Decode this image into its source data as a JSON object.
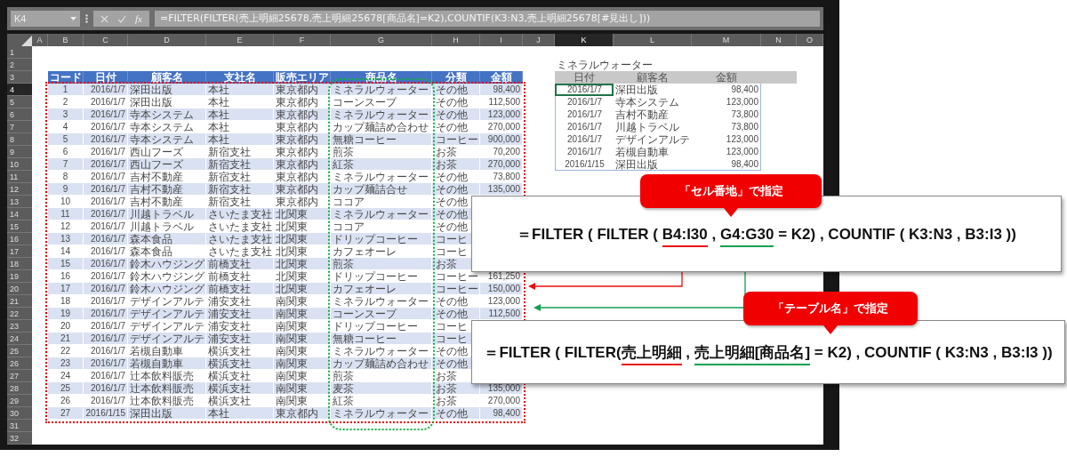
{
  "formula_bar": {
    "name_box": "K4",
    "fx": "fx",
    "formula": "=FILTER(FILTER(売上明細25678,売上明細25678[商品名]=K2),COUNTIF(K3:N3,売上明細25678[#見出し]))"
  },
  "column_headers": [
    {
      "label": "A",
      "selected": false
    },
    {
      "label": "B",
      "selected": false
    },
    {
      "label": "C",
      "selected": false
    },
    {
      "label": "D",
      "selected": false
    },
    {
      "label": "E",
      "selected": false
    },
    {
      "label": "F",
      "selected": false
    },
    {
      "label": "G",
      "selected": false
    },
    {
      "label": "H",
      "selected": false
    },
    {
      "label": "I",
      "selected": false
    },
    {
      "label": "J",
      "selected": false
    },
    {
      "label": "K",
      "selected": true
    },
    {
      "label": "L",
      "selected": false
    },
    {
      "label": "M",
      "selected": false
    },
    {
      "label": "N",
      "selected": false
    },
    {
      "label": "O",
      "selected": false
    }
  ],
  "row_numbers": [
    {
      "label": "1",
      "selected": false
    },
    {
      "label": "2",
      "selected": false
    },
    {
      "label": "3",
      "selected": false
    },
    {
      "label": "4",
      "selected": true
    },
    {
      "label": "5",
      "selected": false
    },
    {
      "label": "6",
      "selected": false
    },
    {
      "label": "7",
      "selected": false
    },
    {
      "label": "8",
      "selected": false
    },
    {
      "label": "9",
      "selected": false
    },
    {
      "label": "10",
      "selected": false
    },
    {
      "label": "11",
      "selected": false
    },
    {
      "label": "12",
      "selected": false
    },
    {
      "label": "13",
      "selected": false
    },
    {
      "label": "14",
      "selected": false
    },
    {
      "label": "15",
      "selected": false
    },
    {
      "label": "16",
      "selected": false
    },
    {
      "label": "17",
      "selected": false
    },
    {
      "label": "18",
      "selected": false
    },
    {
      "label": "19",
      "selected": false
    },
    {
      "label": "20",
      "selected": false
    },
    {
      "label": "21",
      "selected": false
    },
    {
      "label": "22",
      "selected": false
    },
    {
      "label": "23",
      "selected": false
    },
    {
      "label": "24",
      "selected": false
    },
    {
      "label": "25",
      "selected": false
    },
    {
      "label": "26",
      "selected": false
    },
    {
      "label": "27",
      "selected": false
    },
    {
      "label": "28",
      "selected": false
    },
    {
      "label": "29",
      "selected": false
    },
    {
      "label": "30",
      "selected": false
    },
    {
      "label": "31",
      "selected": false
    },
    {
      "label": "32",
      "selected": false
    }
  ],
  "sales_table": {
    "columns": [
      "コード",
      "日付",
      "顧客名",
      "支社名",
      "販売エリア",
      "商品名",
      "分類",
      "金額"
    ],
    "rows": [
      {
        "code": "1",
        "date": "2016/1/7",
        "customer": "深田出版",
        "branch": "本社",
        "area": "東京都内",
        "product": "ミネラルウォーター",
        "category": "その他",
        "amount": "98,400"
      },
      {
        "code": "2",
        "date": "2016/1/7",
        "customer": "深田出版",
        "branch": "本社",
        "area": "東京都内",
        "product": "コーンスープ",
        "category": "その他",
        "amount": "112,500"
      },
      {
        "code": "3",
        "date": "2016/1/7",
        "customer": "寺本システム",
        "branch": "本社",
        "area": "東京都内",
        "product": "ミネラルウォーター",
        "category": "その他",
        "amount": "123,000"
      },
      {
        "code": "4",
        "date": "2016/1/7",
        "customer": "寺本システム",
        "branch": "本社",
        "area": "東京都内",
        "product": "カップ麺詰め合わせ",
        "category": "その他",
        "amount": "270,000"
      },
      {
        "code": "5",
        "date": "2016/1/7",
        "customer": "寺本システム",
        "branch": "本社",
        "area": "東京都内",
        "product": "無糖コーヒー",
        "category": "コーヒー",
        "amount": "900,000"
      },
      {
        "code": "6",
        "date": "2016/1/7",
        "customer": "西山フーズ",
        "branch": "新宿支社",
        "area": "東京都内",
        "product": "煎茶",
        "category": "お茶",
        "amount": "70,200"
      },
      {
        "code": "7",
        "date": "2016/1/7",
        "customer": "西山フーズ",
        "branch": "新宿支社",
        "area": "東京都内",
        "product": "紅茶",
        "category": "お茶",
        "amount": "270,000"
      },
      {
        "code": "8",
        "date": "2016/1/7",
        "customer": "吉村不動産",
        "branch": "新宿支社",
        "area": "東京都内",
        "product": "ミネラルウォーター",
        "category": "その他",
        "amount": "73,800"
      },
      {
        "code": "9",
        "date": "2016/1/7",
        "customer": "吉村不動産",
        "branch": "新宿支社",
        "area": "東京都内",
        "product": "カップ麺詰合せ",
        "category": "その他",
        "amount": "135,000"
      },
      {
        "code": "10",
        "date": "2016/1/7",
        "customer": "吉村不動産",
        "branch": "新宿支社",
        "area": "東京都内",
        "product": "ココア",
        "category": "その他"
      },
      {
        "code": "11",
        "date": "2016/1/7",
        "customer": "川越トラベル",
        "branch": "さいたま支社",
        "area": "北関東",
        "product": "ミネラルウォーター",
        "category": "その他"
      },
      {
        "code": "12",
        "date": "2016/1/7",
        "customer": "川越トラベル",
        "branch": "さいたま支社",
        "area": "北関東",
        "product": "ココア",
        "category": "その他"
      },
      {
        "code": "13",
        "date": "2016/1/7",
        "customer": "森本食品",
        "branch": "さいたま支社",
        "area": "北関東",
        "product": "ドリップコーヒー",
        "category": "コーヒ"
      },
      {
        "code": "14",
        "date": "2016/1/7",
        "customer": "森本食品",
        "branch": "さいたま支社",
        "area": "北関東",
        "product": "カフェオーレ",
        "category": "コーヒ"
      },
      {
        "code": "15",
        "date": "2016/1/7",
        "customer": "鈴木ハウジング",
        "branch": "前橋支社",
        "area": "北関東",
        "product": "煎茶",
        "category": "お茶"
      },
      {
        "code": "16",
        "date": "2016/1/7",
        "customer": "鈴木ハウジング",
        "branch": "前橋支社",
        "area": "北関東",
        "product": "ドリップコーヒー",
        "category": "コーヒー",
        "amount": "161,250"
      },
      {
        "code": "17",
        "date": "2016/1/7",
        "customer": "鈴木ハウジング",
        "branch": "前橋支社",
        "area": "北関東",
        "product": "カフェオーレ",
        "category": "コーヒー",
        "amount": "150,000"
      },
      {
        "code": "18",
        "date": "2016/1/7",
        "customer": "デザインアルテ",
        "branch": "浦安支社",
        "area": "南関東",
        "product": "ミネラルウォーター",
        "category": "その他",
        "amount": "123,000"
      },
      {
        "code": "19",
        "date": "2016/1/7",
        "customer": "デザインアルテ",
        "branch": "浦安支社",
        "area": "南関東",
        "product": "コーンスープ",
        "category": "その他",
        "amount": "112,500"
      },
      {
        "code": "20",
        "date": "2016/1/7",
        "customer": "デザインアルテ",
        "branch": "浦安支社",
        "area": "南関東",
        "product": "ドリップコーヒー",
        "category": "コーヒ"
      },
      {
        "code": "21",
        "date": "2016/1/7",
        "customer": "デザインアルテ",
        "branch": "浦安支社",
        "area": "南関東",
        "product": "無糖コーヒー",
        "category": "コーヒ"
      },
      {
        "code": "22",
        "date": "2016/1/7",
        "customer": "若槻自動車",
        "branch": "横浜支社",
        "area": "南関東",
        "product": "ミネラルウォーター",
        "category": "その他"
      },
      {
        "code": "23",
        "date": "2016/1/7",
        "customer": "若槻自動車",
        "branch": "横浜支社",
        "area": "南関東",
        "product": "カップ麺詰め合わせ",
        "category": "その他"
      },
      {
        "code": "24",
        "date": "2016/1/7",
        "customer": "辻本飲料販売",
        "branch": "横浜支社",
        "area": "南関東",
        "product": "煎茶",
        "category": "お茶"
      },
      {
        "code": "25",
        "date": "2016/1/7",
        "customer": "辻本飲料販売",
        "branch": "横浜支社",
        "area": "南関東",
        "product": "麦茶",
        "category": "お茶",
        "amount": "135,000"
      },
      {
        "code": "26",
        "date": "2016/1/7",
        "customer": "辻本飲料販売",
        "branch": "横浜支社",
        "area": "南関東",
        "product": "紅茶",
        "category": "お茶",
        "amount": "270,000"
      },
      {
        "code": "27",
        "date": "2016/1/15",
        "customer": "深田出版",
        "branch": "本社",
        "area": "東京都内",
        "product": "ミネラルウォーター",
        "category": "その他",
        "amount": "98,400"
      }
    ]
  },
  "result": {
    "title": "ミネラルウォーター",
    "columns": [
      "日付",
      "顧客名",
      "金額"
    ],
    "rows": [
      {
        "date": "2016/1/7",
        "customer": "深田出版",
        "amount": "98,400",
        "selected": true
      },
      {
        "date": "2016/1/7",
        "customer": "寺本システム",
        "amount": "123,000",
        "selected": false
      },
      {
        "date": "2016/1/7",
        "customer": "吉村不動産",
        "amount": "73,800",
        "selected": false
      },
      {
        "date": "2016/1/7",
        "customer": "川越トラベル",
        "amount": "73,800",
        "selected": false
      },
      {
        "date": "2016/1/7",
        "customer": "デザインアルテ",
        "amount": "123,000",
        "selected": false
      },
      {
        "date": "2016/1/7",
        "customer": "若槻自動車",
        "amount": "123,000",
        "selected": false
      },
      {
        "date": "2016/1/15",
        "customer": "深田出版",
        "amount": "98,400",
        "selected": false
      }
    ]
  },
  "callouts": [
    {
      "label": "「セル番地」で指定",
      "formula": [
        {
          "text": "＝FILTER ( FILTER ( "
        },
        {
          "text": "B4:I30",
          "color": "#e81010"
        },
        {
          "text": " , "
        },
        {
          "text": "G4:G30",
          "color": "#10a050"
        },
        {
          "text": " = K2) , COUNTIF ( K3:N3 , B3:I3 ))"
        }
      ]
    },
    {
      "label": "「テーブル名」で指定",
      "formula": [
        {
          "text": "＝FILTER ( FILTER("
        },
        {
          "text": "売上明細",
          "color": "#e81010"
        },
        {
          "text": " , "
        },
        {
          "text": "売上明細[商品名]",
          "color": "#10a050"
        },
        {
          "text": " = K2) , COUNTIF ( K3:N3 , B3:I3 ))"
        }
      ]
    }
  ]
}
